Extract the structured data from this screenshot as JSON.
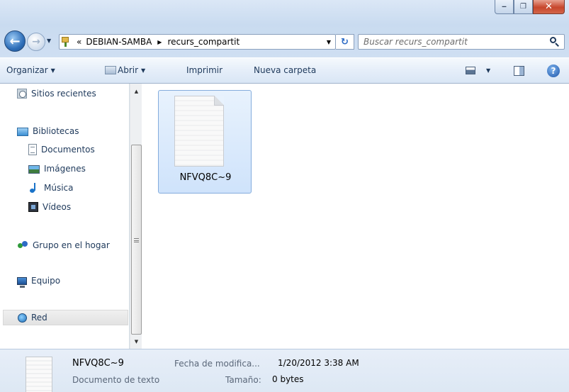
{
  "window": {
    "minimize": "‒",
    "maximize": "❐",
    "close": "✕"
  },
  "address": {
    "chevron": "«",
    "crumbs": [
      "DEBIAN-SAMBA",
      "recurs_compartit"
    ],
    "separator": "▶",
    "dropdown": "▼",
    "refresh": "↻"
  },
  "search": {
    "placeholder": "Buscar recurs_compartit"
  },
  "nav_buttons": {
    "back": "←",
    "forward": "→",
    "dropdown": "▼"
  },
  "toolbar": {
    "organize": "Organizar",
    "open": "Abrir",
    "print": "Imprimir",
    "new_folder": "Nueva carpeta",
    "caret": "▼",
    "help": "?"
  },
  "navpane": {
    "recent": "Sitios recientes",
    "libraries": "Bibliotecas",
    "documents": "Documentos",
    "pictures": "Imágenes",
    "music": "Música",
    "videos": "Vídeos",
    "homegroup": "Grupo en el hogar",
    "computer": "Equipo",
    "network": "Red"
  },
  "scrollbar": {
    "up": "▲",
    "down": "▼"
  },
  "files": [
    {
      "name": "NFVQ8C~9"
    }
  ],
  "details": {
    "name": "NFVQ8C~9",
    "type": "Documento de texto",
    "date_label": "Fecha de modifica...",
    "date": "1/20/2012 3:38 AM",
    "size_label": "Tamaño:",
    "size": "0 bytes"
  },
  "colors": {
    "accent": "#1e395b",
    "selection": "#cfe3fb",
    "close": "#c7462c"
  }
}
